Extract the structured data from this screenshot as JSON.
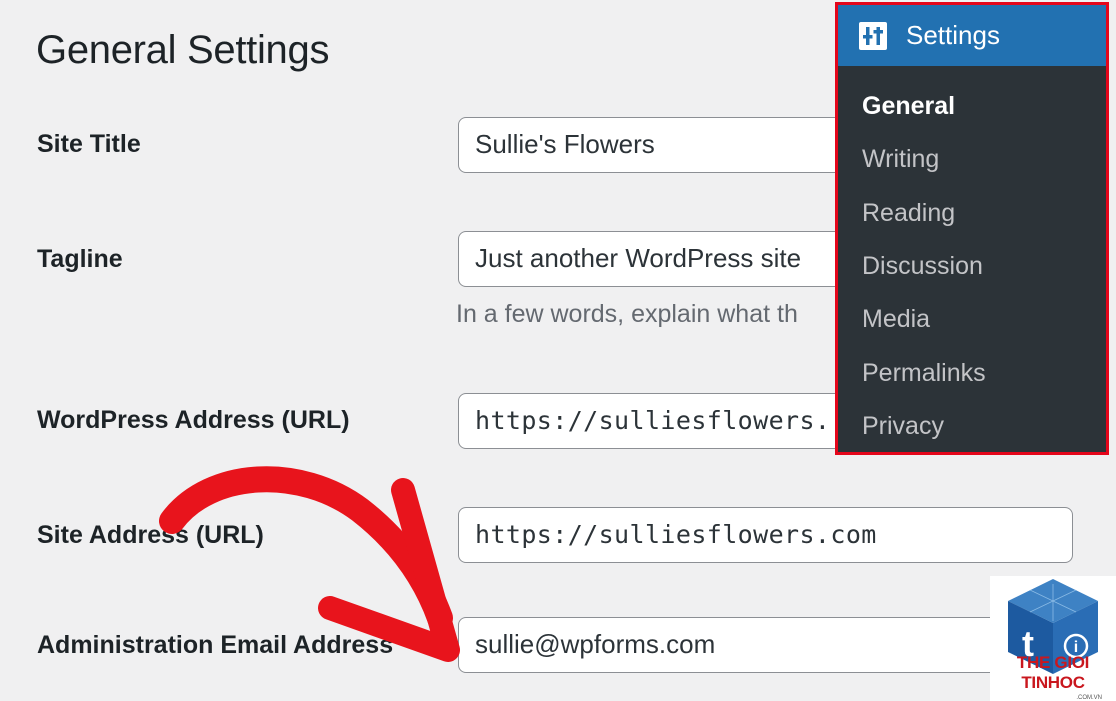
{
  "page": {
    "title": "General Settings"
  },
  "fields": {
    "site_title": {
      "label": "Site Title",
      "value": "Sullie's Flowers"
    },
    "tagline": {
      "label": "Tagline",
      "value": "Just another WordPress site",
      "help": "In a few words, explain what th"
    },
    "wordpress_address": {
      "label": "WordPress Address (URL)",
      "value": "https://sulliesflowers."
    },
    "site_address": {
      "label": "Site Address (URL)",
      "value": "https://sulliesflowers.com"
    },
    "admin_email": {
      "label": "Administration Email Address",
      "value": "sullie@wpforms.com"
    }
  },
  "settings_menu": {
    "header": "Settings",
    "icon": "settings-sliders-icon",
    "items": [
      {
        "label": "General",
        "current": true
      },
      {
        "label": "Writing"
      },
      {
        "label": "Reading"
      },
      {
        "label": "Discussion"
      },
      {
        "label": "Media"
      },
      {
        "label": "Permalinks"
      },
      {
        "label": "Privacy"
      }
    ]
  },
  "watermark": {
    "text": "THE GIOI TINHOC",
    "sub": ".COM.VN"
  },
  "colors": {
    "menu_bg": "#2c3338",
    "menu_header": "#2271b1",
    "highlight_border": "#e4061b",
    "arrow": "#e8141c",
    "page_bg": "#f0f0f1"
  }
}
